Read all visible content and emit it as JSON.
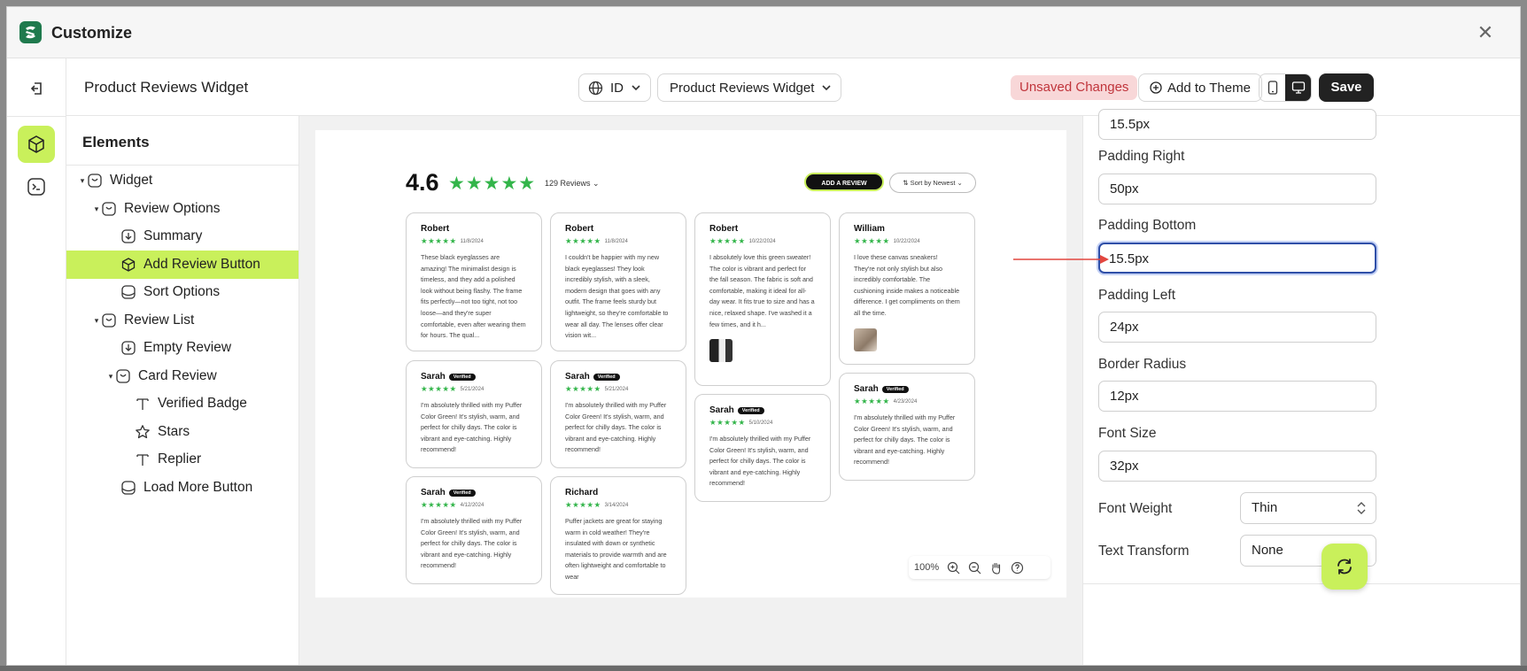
{
  "window": {
    "title": "Customize",
    "close_symbol": "✕"
  },
  "header": {
    "widget_title": "Product Reviews Widget",
    "language_label": "ID",
    "widget_select": "Product Reviews Widget",
    "unsaved_label": "Unsaved Changes",
    "add_theme_label": "Add to Theme",
    "save_label": "Save"
  },
  "tree": {
    "title": "Elements",
    "items": [
      {
        "label": "Widget",
        "caret": "▾"
      },
      {
        "label": "Review Options",
        "caret": "▾"
      },
      {
        "label": "Summary"
      },
      {
        "label": "Add Review Button"
      },
      {
        "label": "Sort Options"
      },
      {
        "label": "Review List",
        "caret": "▾"
      },
      {
        "label": "Empty Review"
      },
      {
        "label": "Card Review",
        "caret": "▾"
      },
      {
        "label": "Verified Badge"
      },
      {
        "label": "Stars"
      },
      {
        "label": "Replier"
      },
      {
        "label": "Load More Button"
      }
    ]
  },
  "preview": {
    "rating": "4.6",
    "stars": "★★★★★",
    "reviews_count": "129 Reviews ⌄",
    "add_review_label": "ADD A REVIEW",
    "sort_label": "⇅  Sort by Newest  ⌄",
    "cards": [
      {
        "name": "Robert",
        "verified": "",
        "stars": "★★★★★",
        "date": "11/8/2024",
        "body": "These black eyeglasses are amazing! The minimalist design is timeless, and they add a polished look without being flashy. The frame fits perfectly—not too tight, not too loose—and they're super comfortable, even after wearing them for hours. The qual..."
      },
      {
        "name": "Robert",
        "verified": "",
        "stars": "★★★★★",
        "date": "11/8/2024",
        "body": "I couldn't be happier with my new black eyeglasses! They look incredibly stylish, with a sleek, modern design that goes with any outfit. The frame feels sturdy but lightweight, so they're comfortable to wear all day. The lenses offer clear vision wit..."
      },
      {
        "name": "Robert",
        "verified": "",
        "stars": "★★★★★",
        "date": "10/22/2024",
        "body": "I absolutely love this green sweater! The color is vibrant and perfect for the fall season. The fabric is soft and comfortable, making it ideal for all-day wear. It fits true to size and has a nice, relaxed shape. I've washed it a few times, and it h..."
      },
      {
        "name": "William",
        "verified": "",
        "stars": "★★★★★",
        "date": "10/22/2024",
        "body": "I love these canvas sneakers! They're not only stylish but also incredibly comfortable. The cushioning inside makes a noticeable difference. I get compliments on them all the time."
      },
      {
        "name": "Sarah",
        "verified": "Verified",
        "stars": "★★★★★",
        "date": "5/21/2024",
        "body": "I'm absolutely thrilled with my Puffer Color Green! It's stylish, warm, and perfect for chilly days. The color is vibrant and eye-catching. Highly recommend!"
      },
      {
        "name": "Sarah",
        "verified": "Verified",
        "stars": "★★★★★",
        "date": "5/21/2024",
        "body": "I'm absolutely thrilled with my Puffer Color Green! It's stylish, warm, and perfect for chilly days. The color is vibrant and eye-catching. Highly recommend!"
      },
      {
        "name": "Sarah",
        "verified": "Verified",
        "stars": "★★★★★",
        "date": "5/10/2024",
        "body": "I'm absolutely thrilled with my Puffer Color Green! It's stylish, warm, and perfect for chilly days. The color is vibrant and eye-catching. Highly recommend!"
      },
      {
        "name": "Sarah",
        "verified": "Verified",
        "stars": "★★★★★",
        "date": "4/23/2024",
        "body": "I'm absolutely thrilled with my Puffer Color Green! It's stylish, warm, and perfect for chilly days. The color is vibrant and eye-catching. Highly recommend!"
      },
      {
        "name": "Sarah",
        "verified": "Verified",
        "stars": "★★★★★",
        "date": "4/12/2024",
        "body": "I'm absolutely thrilled with my Puffer Color Green! It's stylish, warm, and perfect for chilly days. The color is vibrant and eye-catching. Highly recommend!"
      },
      {
        "name": "Richard",
        "verified": "",
        "stars": "★★★★★",
        "date": "3/14/2024",
        "body": "Puffer jackets are great for staying warm in cold weather! They're insulated with down or synthetic materials to provide warmth and are often lightweight and comfortable to wear"
      }
    ],
    "zoom_level": "100%"
  },
  "panel": {
    "top_value": "15.5px",
    "padding_right_label": "Padding Right",
    "padding_right_value": "50px",
    "padding_bottom_label": "Padding Bottom",
    "padding_bottom_value": "15.5px",
    "padding_left_label": "Padding Left",
    "padding_left_value": "24px",
    "border_radius_label": "Border Radius",
    "border_radius_value": "12px",
    "font_size_label": "Font Size",
    "font_size_value": "32px",
    "font_weight_label": "Font Weight",
    "font_weight_value": "Thin",
    "text_transform_label": "Text Transform",
    "text_transform_value": "None"
  },
  "colors": {
    "accent": "#c9f05b",
    "star": "#33b54a",
    "unsaved_bg": "#f8d7d8",
    "unsaved_text": "#c0343b",
    "focus": "#2f4fa8",
    "annotation": "#e2463f"
  }
}
